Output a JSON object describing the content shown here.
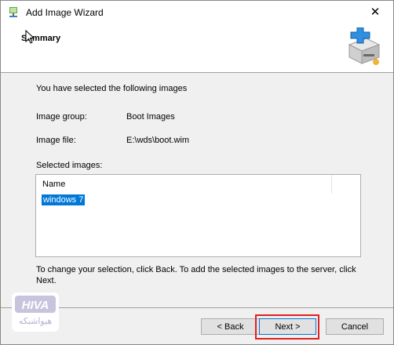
{
  "window": {
    "title": "Add Image Wizard",
    "close_glyph": "✕"
  },
  "header": {
    "title": "Summary"
  },
  "content": {
    "intro": "You have selected the following images",
    "image_group_label": "Image group:",
    "image_group_value": "Boot Images",
    "image_file_label": "Image file:",
    "image_file_value": "E:\\wds\\boot.wim",
    "selected_label": "Selected images:",
    "list": {
      "column": "Name",
      "items": [
        "windows 7"
      ]
    },
    "footer_text": "To change your selection, click Back. To add the selected images to the server, click Next."
  },
  "buttons": {
    "back": "< Back",
    "next": "Next >",
    "cancel": "Cancel"
  },
  "watermark": {
    "text": "هیواشبکه"
  },
  "colors": {
    "selection": "#0078d7",
    "highlight_border": "#e02020"
  }
}
